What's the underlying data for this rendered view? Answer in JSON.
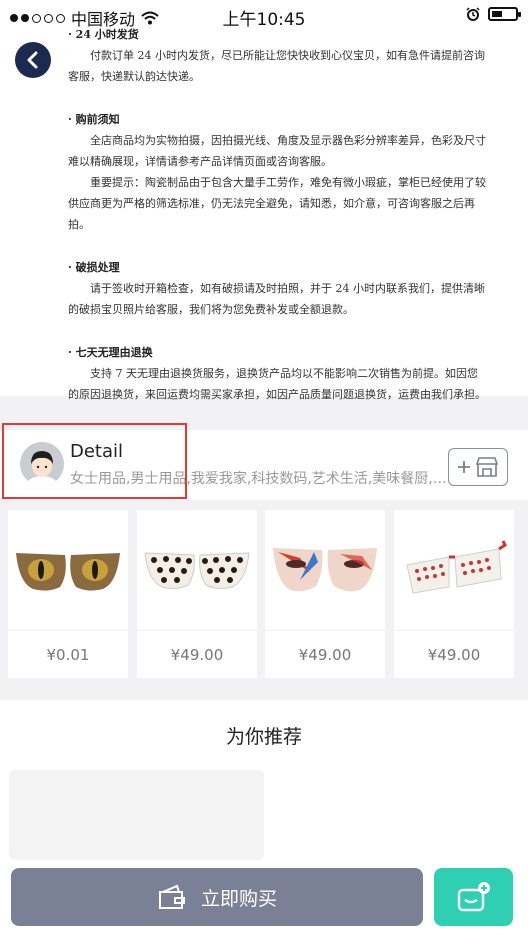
{
  "status_bar": {
    "carrier": "中国移动",
    "time": "上午10:45"
  },
  "policy": {
    "sections": [
      {
        "title": "· 24 小时发货",
        "paragraphs": [
          "付款订单 24 小时内发货，尽已所能让您快快收到心仪宝贝，如有急件请提前咨询客服，快递默认韵达快递。"
        ]
      },
      {
        "title": "· 购前须知",
        "paragraphs": [
          "全店商品均为实物拍摄，因拍摄光线、角度及显示器色彩分辨率差异，色彩及尺寸难以精确展现，详情请参考产品详情页面或咨询客服。",
          "重要提示：陶瓷制品由于包含大量手工劳作，难免有微小瑕疵，掌柜已经使用了较供应商更为严格的筛选标准，仍无法完全避免，请知悉，如介意，可咨询客服之后再拍。"
        ]
      },
      {
        "title": "· 破损处理",
        "paragraphs": [
          "请于签收时开箱检查，如有破损请及时拍照，并于 24 小时内联系我们，提供清晰的破损宝贝照片给客服，我们将为您免费补发或全额退款。"
        ]
      },
      {
        "title": "· 七天无理由退换",
        "paragraphs": [
          "支持 7 天无理由退换货服务，退换货产品均以不能影响二次销售为前提。如因您的原因退换货，来回运费均需买家承担，如因产品质量问题退换货，运费由我们承担。"
        ]
      }
    ]
  },
  "shop": {
    "name": "Detail",
    "categories": "女士用品,男士用品,我爱我家,科技数码,艺术生活,美味餐厨,…"
  },
  "products": [
    {
      "price": "¥0.01",
      "icon": "cat-eye-glasses"
    },
    {
      "price": "¥49.00",
      "icon": "polka-dot-glasses"
    },
    {
      "price": "¥49.00",
      "icon": "painted-face-glasses"
    },
    {
      "price": "¥49.00",
      "icon": "red-white-shutter-glasses"
    }
  ],
  "recommend": {
    "title": "为你推荐"
  },
  "bottom": {
    "buy_label": "立即购买"
  },
  "colors": {
    "buy_button": "#7a8096",
    "cart_button": "#2ecfb3",
    "back_button": "#1b2a4e",
    "highlight": "#e53935"
  }
}
